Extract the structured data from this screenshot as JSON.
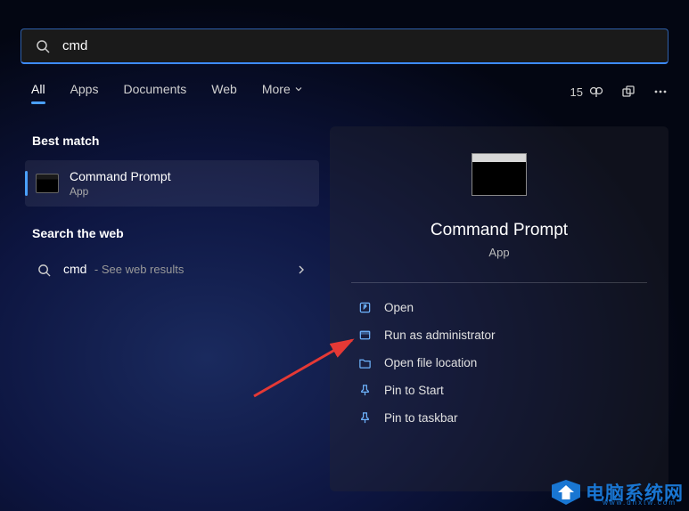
{
  "search": {
    "query": "cmd"
  },
  "tabs": {
    "items": [
      "All",
      "Apps",
      "Documents",
      "Web",
      "More"
    ]
  },
  "rewards": {
    "count": "15"
  },
  "sections": {
    "bestMatch": "Best match",
    "searchWeb": "Search the web"
  },
  "result": {
    "title": "Command Prompt",
    "subtitle": "App"
  },
  "webResult": {
    "query": "cmd",
    "suffix": "- See web results"
  },
  "detail": {
    "title": "Command Prompt",
    "subtitle": "App",
    "actions": {
      "open": "Open",
      "runAdmin": "Run as administrator",
      "openLocation": "Open file location",
      "pinStart": "Pin to Start",
      "pinTaskbar": "Pin to taskbar"
    }
  },
  "watermark": {
    "text": "电脑系统网",
    "url": "www.dnxtw.com"
  }
}
